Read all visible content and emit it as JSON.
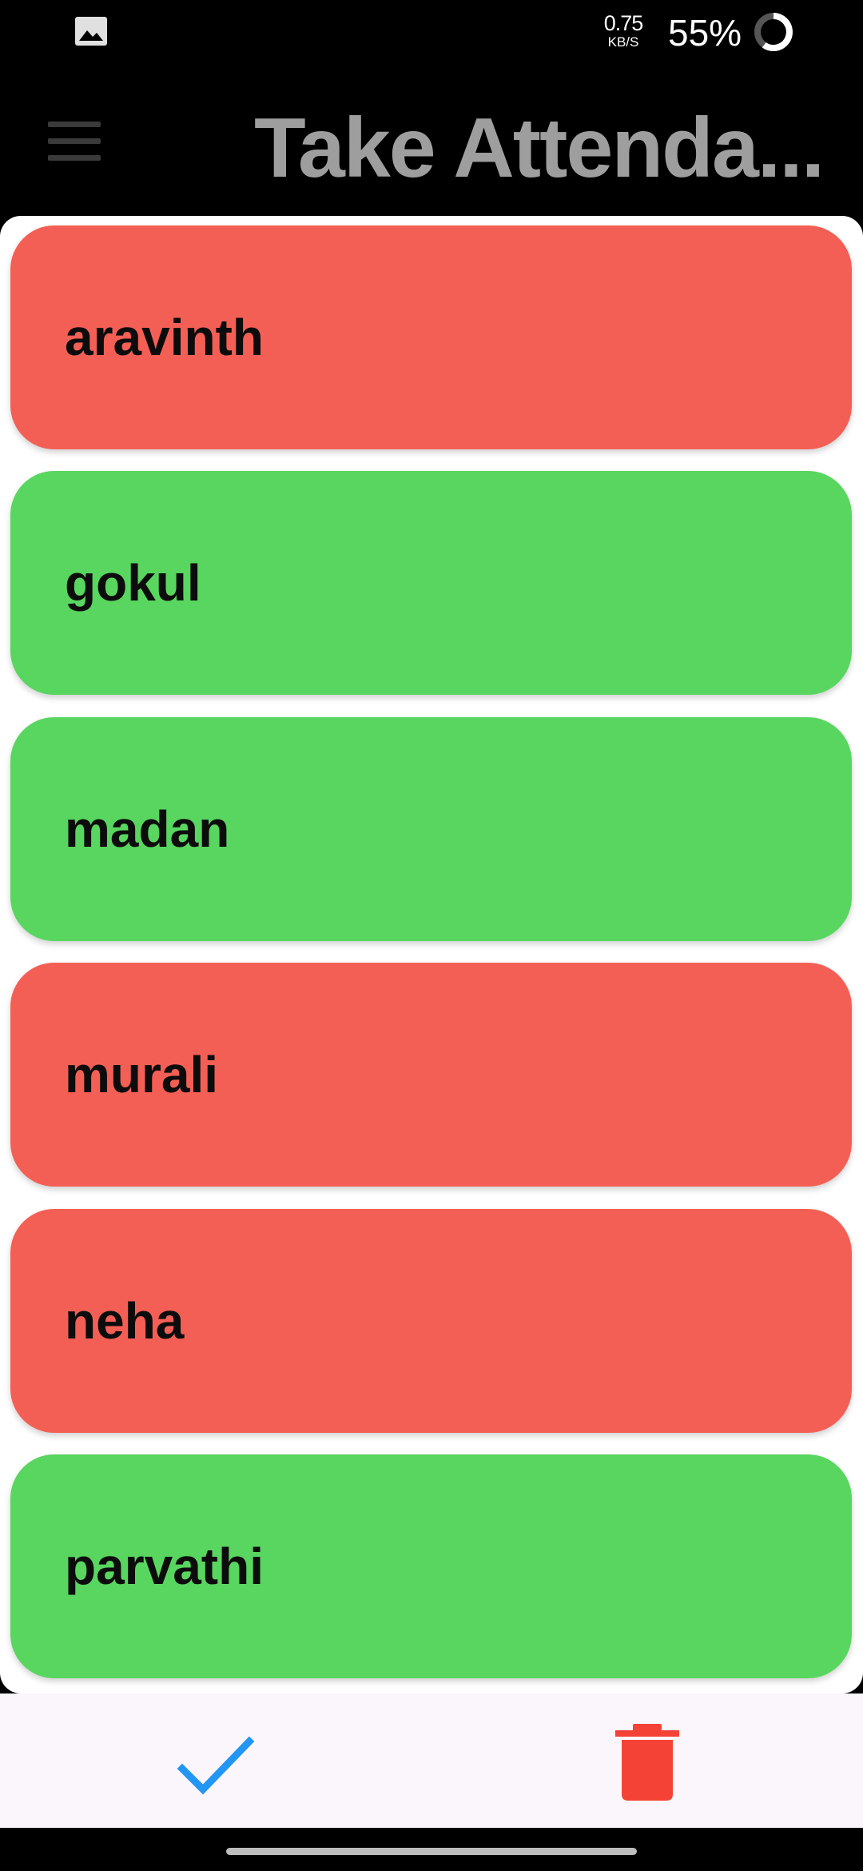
{
  "status_bar": {
    "net_speed_value": "0.75",
    "net_speed_unit": "KB/S",
    "battery_percent": "55%"
  },
  "app_bar": {
    "title": "Take Attenda..."
  },
  "students": [
    {
      "name": "aravinth",
      "status": "absent"
    },
    {
      "name": "gokul",
      "status": "present"
    },
    {
      "name": "madan",
      "status": "present"
    },
    {
      "name": "murali",
      "status": "absent"
    },
    {
      "name": "neha",
      "status": "absent"
    },
    {
      "name": "parvathi",
      "status": "present"
    }
  ],
  "colors": {
    "absent": "#f45f55",
    "present": "#58d65f",
    "check_icon": "#2196f3",
    "delete_icon": "#f44336",
    "bottom_bar": "#fbf5fc"
  },
  "icons": {
    "status_left": "image-icon",
    "battery": "battery-ring-icon",
    "menu": "menu-icon",
    "confirm": "check-icon",
    "delete": "trash-icon"
  }
}
